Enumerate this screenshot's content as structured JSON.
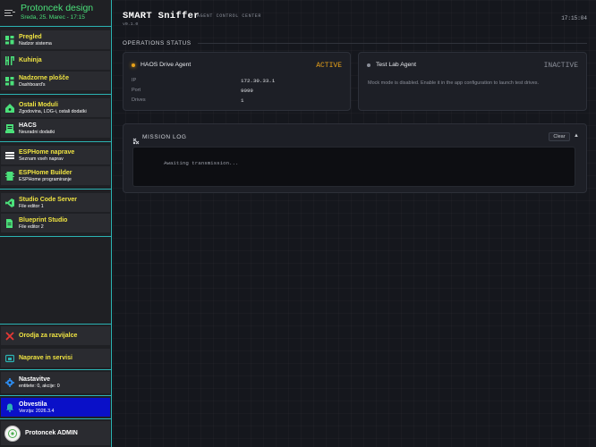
{
  "sidebar": {
    "brand": {
      "title": "Protoncek design",
      "date": "Sreda, 25. Marec - 17:15"
    },
    "groups": [
      {
        "items": [
          {
            "title": "Pregled",
            "sub": "Nadzor sistema",
            "icon": "dashboard-icon"
          },
          {
            "title": "Kuhinja",
            "sub": "",
            "icon": "kitchen-icon"
          },
          {
            "title": "Nadzorne plošče",
            "sub": "Dashboard's",
            "icon": "dashboard-icon"
          }
        ]
      },
      {
        "items": [
          {
            "title": "Ostali Moduli",
            "sub": "Zgodovina, LOG-i, ostali dodatki",
            "icon": "home-assistant-icon"
          },
          {
            "title": "HACS",
            "sub": "Neuradni dodatki",
            "icon": "hacs-icon"
          }
        ]
      },
      {
        "items": [
          {
            "title": "ESPHome naprave",
            "sub": "Seznam vseh naprav",
            "icon": "esphome-icon"
          },
          {
            "title": "ESPHome Builder",
            "sub": "ESPHome programiranje",
            "icon": "chip-icon"
          }
        ]
      },
      {
        "items": [
          {
            "title": "Studio Code Server",
            "sub": "File editor 1",
            "icon": "vscode-icon"
          },
          {
            "title": "Blueprint Studio",
            "sub": "File editor 2",
            "icon": "file-edit-icon"
          }
        ]
      }
    ],
    "bottom": {
      "tools": {
        "title": "Orodja za razvijalce",
        "icon": "hammer-icon"
      },
      "devices": {
        "title": "Naprave in servisi",
        "icon": "devices-icon"
      },
      "settings": {
        "title": "Nastavitve",
        "sub": "entitete: 0, akcije: 0",
        "icon": "gear-icon"
      },
      "notifications": {
        "title": "Obvestila",
        "sub": "Verzija: 2026.3.4",
        "icon": "bell-icon"
      },
      "user": {
        "name": "Protoncek ADMIN",
        "icon": "avatar"
      }
    },
    "colors": {
      "accent": "#2bb3b3",
      "title": "#f0e442",
      "brand": "#4be07a",
      "notification_bg": "#0a10c8"
    }
  },
  "header": {
    "title": "SMART Sniffer",
    "subtitle": "AGENT CONTROL CENTER",
    "version": "v0.1.0",
    "clock": "17:15:04"
  },
  "operations": {
    "section_title": "OPERATIONS STATUS",
    "agents": [
      {
        "name": "HAOS Drive Agent",
        "status": "ACTIVE",
        "status_color": "#e8a21a",
        "fields": [
          {
            "key": "IP",
            "value": "172.30.33.1"
          },
          {
            "key": "Port",
            "value": "9099"
          },
          {
            "key": "Drives",
            "value": "1"
          }
        ]
      },
      {
        "name": "Test Lab Agent",
        "status": "INACTIVE",
        "status_color": "#8b8f99",
        "message": "Mock mode is disabled. Enable it in the app configuration to launch test drives."
      }
    ]
  },
  "mission_log": {
    "title": "MISSION LOG",
    "clear_label": "Clear",
    "collapse_icon": "▲",
    "line": "Awaiting transmission..."
  }
}
